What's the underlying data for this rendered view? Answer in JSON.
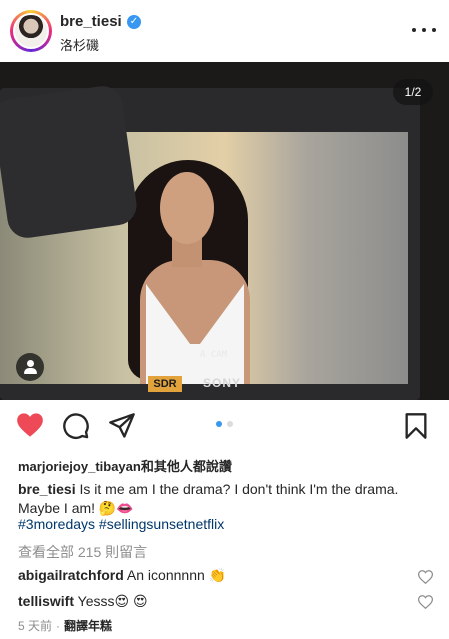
{
  "header": {
    "username": "bre_tiesi",
    "location": "洛杉磯",
    "verified_mark": "✓"
  },
  "photo": {
    "counter": "1/2",
    "camera_label": "A CAM",
    "badge": "SDR",
    "brand": "SONY"
  },
  "carousel": {
    "total": 2,
    "active": 1
  },
  "likes": {
    "user": "marjoriejoy_tibayan",
    "suffix": "和其他人都說讚"
  },
  "caption": {
    "user": "bre_tiesi",
    "text": "Is it me am I the drama? I don't think I'm the drama. Maybe I am! 🤔👄",
    "hashtags": "#3moredays #sellingsunsetnetflix"
  },
  "view_comments": "查看全部 215 則留言",
  "comments": [
    {
      "user": "abigailratchford",
      "text": "An iconnnnn 👏"
    },
    {
      "user": "telliswift",
      "text": "Yesss😍 😍"
    }
  ],
  "footer": {
    "time": "5 天前",
    "separator": "·",
    "translate": "翻譯年糕"
  },
  "colors": {
    "like_red": "#ed4956",
    "hashtag_blue": "#00376b",
    "dot_active": "#3897f0",
    "dot_inactive": "#dbdbdb"
  }
}
